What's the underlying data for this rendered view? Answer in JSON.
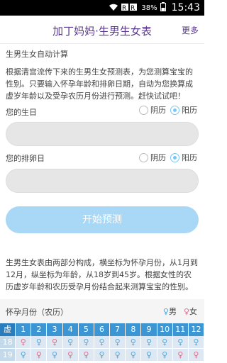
{
  "status_bar": {
    "battery": "38%",
    "time": "15:43"
  },
  "header": {
    "title": "加丁妈妈·生男生女表",
    "more": "更多"
  },
  "section_title": "生男生女自动计算",
  "intro": "根据清宫流传下来的生男生女预测表，为您测算宝宝的性别。只要输入怀孕年龄和排卵日期，自动为您换算成虚岁年龄以及受孕农历月份进行预测。赶快试试吧！",
  "birthday": {
    "label": "您的生日",
    "lunar": "阴历",
    "solar": "阳历",
    "selected": "阳历",
    "value": ""
  },
  "ovulation": {
    "label": "您的排卵日",
    "lunar": "阴历",
    "solar": "阳历",
    "selected": "阳历",
    "value": ""
  },
  "start_button": "开始预测",
  "description": "生男生女表由两部分构成，横坐标为怀孕月份，从1月到12月，纵坐标为年龄，从18岁到45岁。根据女性的农历虚岁年龄和农历受孕月份结合起来测算宝宝的性别。",
  "table": {
    "title": "怀孕月份（农历）",
    "legend_male": "男",
    "legend_female": "女",
    "corner": "虚岁",
    "months": [
      "1",
      "2",
      "3",
      "4",
      "5",
      "6",
      "7",
      "8",
      "9",
      "10",
      "11",
      "12"
    ],
    "rows": [
      {
        "age": "18",
        "cells": [
          "f",
          "m",
          "f",
          "m",
          "m",
          "m",
          "m",
          "m",
          "m",
          "m",
          "m",
          "m"
        ]
      },
      {
        "age": "19",
        "cells": [
          "m",
          "f",
          "m",
          "f",
          "f",
          "m",
          "m",
          "m",
          "m",
          "m",
          "f",
          "f"
        ]
      }
    ]
  }
}
